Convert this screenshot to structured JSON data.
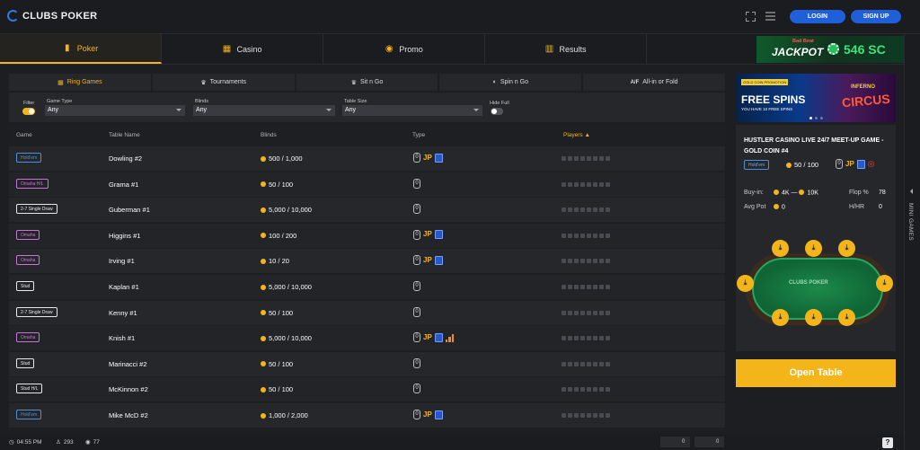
{
  "header": {
    "logo_text": "CLUBS POKER",
    "login_label": "LOGIN",
    "signup_label": "SIGN UP"
  },
  "nav": {
    "tabs": [
      {
        "label": "Poker",
        "icon": "cards-icon",
        "active": true
      },
      {
        "label": "Casino",
        "icon": "slot-icon",
        "active": false
      },
      {
        "label": "Promo",
        "icon": "medal-icon",
        "active": false
      },
      {
        "label": "Results",
        "icon": "chart-icon",
        "active": false
      }
    ]
  },
  "jackpot": {
    "badge": "Bad Beat",
    "label": "JACKPOT",
    "amount": "546 SC"
  },
  "game_tabs": [
    {
      "label": "Ring Games",
      "icon": "chips-icon",
      "active": true
    },
    {
      "label": "Tournaments",
      "icon": "trophy-icon",
      "active": false
    },
    {
      "label": "Sit n Go",
      "icon": "trophy-icon",
      "active": false
    },
    {
      "label": "Spin n Go",
      "icon": "spin-icon",
      "active": false
    },
    {
      "label": "All-in or Fold",
      "icon": "aof-icon",
      "active": false
    }
  ],
  "filters": {
    "filter_label": "Filter",
    "game_type_label": "Game Type",
    "game_type_value": "Any",
    "blinds_label": "Blinds",
    "blinds_value": "Any",
    "table_size_label": "Table Size",
    "table_size_value": "Any",
    "hide_full_label": "Hide Full"
  },
  "table": {
    "headers": {
      "game": "Game",
      "name": "Table Name",
      "blinds": "Blinds",
      "type": "Type",
      "players": "Players"
    },
    "rows": [
      {
        "game": "Hold'em",
        "name": "Dowling #2",
        "blinds": "500 / 1,000",
        "badge_color": "#4d8fd8",
        "jp": true,
        "card": true,
        "bars": false
      },
      {
        "game": "Omaha H/L",
        "name": "Grama #1",
        "blinds": "50 / 100",
        "badge_color": "#c774d6",
        "jp": false,
        "card": false,
        "bars": false
      },
      {
        "game": "2-7 Single Draw",
        "name": "Guberman #1",
        "blinds": "5,000 / 10,000",
        "badge_color": "#e8e8e8",
        "jp": false,
        "card": false,
        "bars": false
      },
      {
        "game": "Omaha",
        "name": "Higgins #1",
        "blinds": "100 / 200",
        "badge_color": "#c774d6",
        "jp": true,
        "card": true,
        "bars": false
      },
      {
        "game": "Omaha",
        "name": "Irving #1",
        "blinds": "10 / 20",
        "badge_color": "#c774d6",
        "jp": true,
        "card": true,
        "bars": false
      },
      {
        "game": "Stud",
        "name": "Kaplan #1",
        "blinds": "5,000 / 10,000",
        "badge_color": "#e8e8e8",
        "jp": false,
        "card": false,
        "bars": false
      },
      {
        "game": "2-7 Single Draw",
        "name": "Kenny #1",
        "blinds": "50 / 100",
        "badge_color": "#e8e8e8",
        "jp": false,
        "card": false,
        "bars": false
      },
      {
        "game": "Omaha",
        "name": "Knish #1",
        "blinds": "5,000 / 10,000",
        "badge_color": "#c774d6",
        "jp": true,
        "card": true,
        "bars": true
      },
      {
        "game": "Stud",
        "name": "Marinacci #2",
        "blinds": "50 / 100",
        "badge_color": "#e8e8e8",
        "jp": false,
        "card": false,
        "bars": false
      },
      {
        "game": "Stud H/L",
        "name": "McKinnon #2",
        "blinds": "50 / 100",
        "badge_color": "#e8e8e8",
        "jp": false,
        "card": false,
        "bars": false
      },
      {
        "game": "Hold'em",
        "name": "Mike McD #2",
        "blinds": "1,000 / 2,000",
        "badge_color": "#4d8fd8",
        "jp": true,
        "card": true,
        "bars": false
      }
    ]
  },
  "footer": {
    "time": "04:55 PM",
    "players": "293",
    "watchers": "77",
    "box1": "0",
    "box2": "0",
    "help": "?"
  },
  "banner": {
    "tag": "GOLD COIN PROMOTION",
    "headline": "FREE SPINS",
    "subline": "YOU HAVE 10 FREE SPINS",
    "game_name": "CIRCUS",
    "game_prefix": "INFERNO"
  },
  "detail": {
    "title": "HUSTLER CASINO LIVE 24/7 MEET-UP GAME - GOLD COIN #4",
    "game": "Hold'em",
    "blinds": "50 / 100",
    "buyin_label": "Buy-in:",
    "buyin_min": "4K",
    "buyin_max": "10K",
    "avg_pot_label": "Avg Pot",
    "avg_pot": "0",
    "flop_label": "Flop %",
    "flop": "78",
    "hhr_label": "H/HR",
    "hhr": "0",
    "table_logo": "CLUBS POKER"
  },
  "open_table_label": "Open Table",
  "mini_games_label": "MINI GAMES",
  "colors": {
    "accent": "#f3b51a",
    "blue": "#1f5fd9",
    "jackpot_green": "#3ee37a"
  }
}
